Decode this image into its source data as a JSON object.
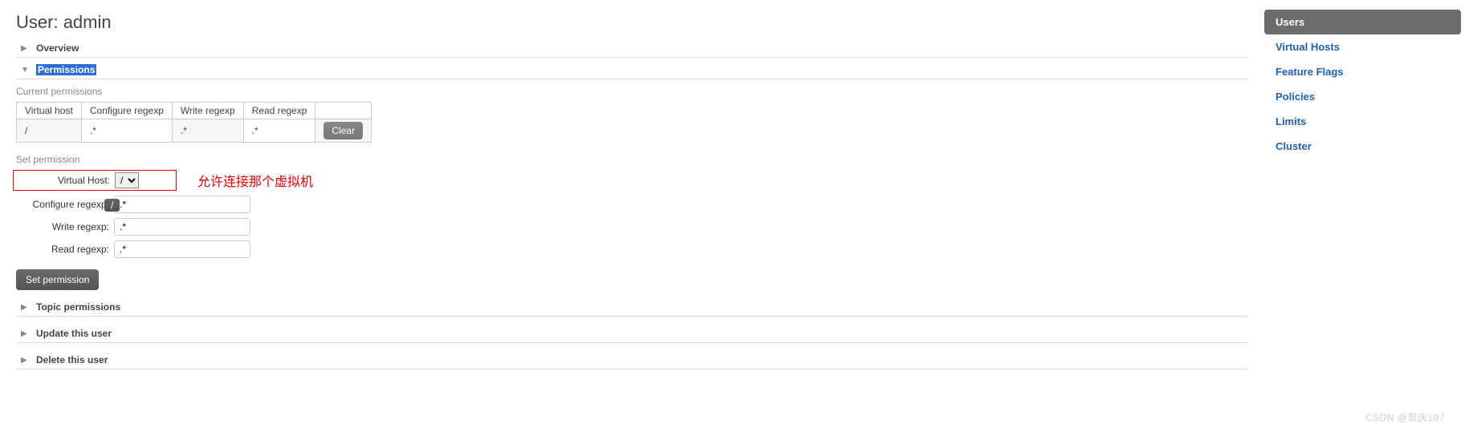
{
  "header": {
    "prefix": "User: ",
    "name": "admin"
  },
  "sections": {
    "overview": "Overview",
    "permissions": "Permissions",
    "topic_permissions": "Topic permissions",
    "update_user": "Update this user",
    "delete_user": "Delete this user"
  },
  "perms": {
    "current_label": "Current permissions",
    "headers": [
      "Virtual host",
      "Configure regexp",
      "Write regexp",
      "Read regexp"
    ],
    "rows": [
      {
        "vhost": "/",
        "configure": ".*",
        "write": ".*",
        "read": ".*"
      }
    ],
    "clear_label": "Clear"
  },
  "set_perm": {
    "title": "Set permission",
    "vhost_label": "Virtual Host:",
    "vhost_selected": "/",
    "vhost_options": [
      "/"
    ],
    "configure_label": "Configure regexp:",
    "configure_value": ".*",
    "write_label": "Write regexp:",
    "write_value": ".*",
    "read_label": "Read regexp:",
    "read_value": ".*",
    "submit_label": "Set permission",
    "tooltip": "/"
  },
  "annotation": {
    "text": "允许连接那个虚拟机"
  },
  "right_nav": [
    {
      "label": "Users",
      "active": true
    },
    {
      "label": "Virtual Hosts",
      "active": false
    },
    {
      "label": "Feature Flags",
      "active": false
    },
    {
      "label": "Policies",
      "active": false
    },
    {
      "label": "Limits",
      "active": false
    },
    {
      "label": "Cluster",
      "active": false
    }
  ],
  "watermark": "CSDN @景庆197"
}
